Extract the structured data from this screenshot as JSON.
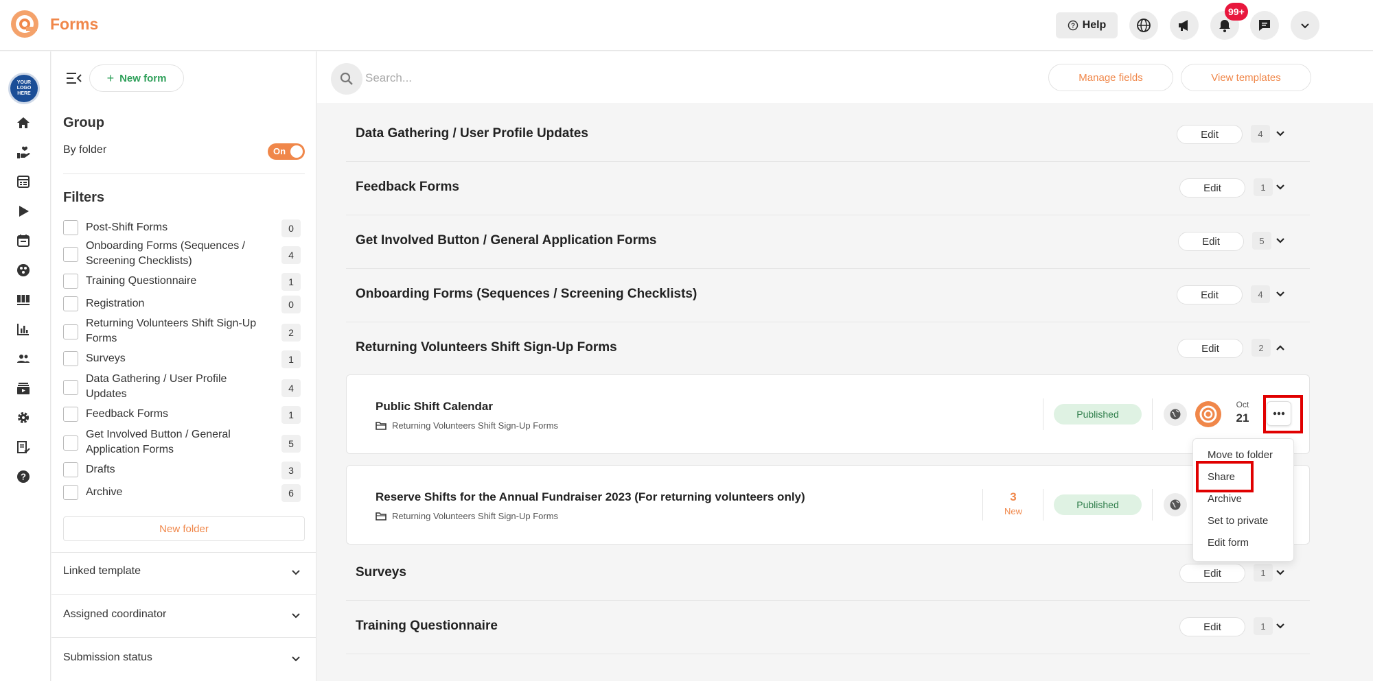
{
  "header": {
    "app_title": "Forms",
    "help_label": "Help",
    "notification_count": "99+",
    "logo_text": "YOUR LOGO HERE"
  },
  "panel": {
    "new_form_label": "New form",
    "group_heading": "Group",
    "by_folder_label": "By folder",
    "toggle_label": "On",
    "filters_heading": "Filters",
    "filters": [
      {
        "label": "Post-Shift Forms",
        "count": "0"
      },
      {
        "label": "Onboarding Forms (Sequences / Screening Checklists)",
        "count": "4"
      },
      {
        "label": "Training Questionnaire",
        "count": "1"
      },
      {
        "label": "Registration",
        "count": "0"
      },
      {
        "label": "Returning Volunteers Shift Sign-Up Forms",
        "count": "2"
      },
      {
        "label": "Surveys",
        "count": "1"
      },
      {
        "label": "Data Gathering / User Profile Updates",
        "count": "4"
      },
      {
        "label": "Feedback Forms",
        "count": "1"
      },
      {
        "label": "Get Involved Button / General Application Forms",
        "count": "5"
      },
      {
        "label": "Drafts",
        "count": "3"
      },
      {
        "label": "Archive",
        "count": "6"
      }
    ],
    "new_folder_label": "New folder",
    "sections": [
      "Linked template",
      "Assigned coordinator",
      "Submission status"
    ]
  },
  "toolbar": {
    "search_placeholder": "Search...",
    "manage_fields_label": "Manage fields",
    "view_templates_label": "View templates"
  },
  "groups": [
    {
      "title": "Data Gathering / User Profile Updates",
      "edit": "Edit",
      "count": "4",
      "expanded": false
    },
    {
      "title": "Feedback Forms",
      "edit": "Edit",
      "count": "1",
      "expanded": false
    },
    {
      "title": "Get Involved Button / General Application Forms",
      "edit": "Edit",
      "count": "5",
      "expanded": false
    },
    {
      "title": "Onboarding Forms (Sequences / Screening Checklists)",
      "edit": "Edit",
      "count": "4",
      "expanded": false
    },
    {
      "title": "Returning Volunteers Shift Sign-Up Forms",
      "edit": "Edit",
      "count": "2",
      "expanded": true
    },
    {
      "title": "Surveys",
      "edit": "Edit",
      "count": "1",
      "expanded": false
    },
    {
      "title": "Training Questionnaire",
      "edit": "Edit",
      "count": "1",
      "expanded": false
    }
  ],
  "forms": [
    {
      "title": "Public Shift Calendar",
      "folder": "Returning Volunteers Shift Sign-Up Forms",
      "status": "Published",
      "date_month": "Oct",
      "date_day": "21"
    },
    {
      "title": "Reserve Shifts for the Annual Fundraiser 2023 (For returning volunteers only)",
      "folder": "Returning Volunteers Shift Sign-Up Forms",
      "new_count": "3",
      "new_label": "New",
      "status": "Published"
    }
  ],
  "context_menu": {
    "items": [
      "Move to folder",
      "Share",
      "Archive",
      "Set to private",
      "Edit form"
    ]
  },
  "colors": {
    "accent": "#f0874a",
    "success_bg": "#dff2e3",
    "success_text": "#2e7d4a",
    "highlight": "#e00000",
    "notification": "#e8173d"
  }
}
